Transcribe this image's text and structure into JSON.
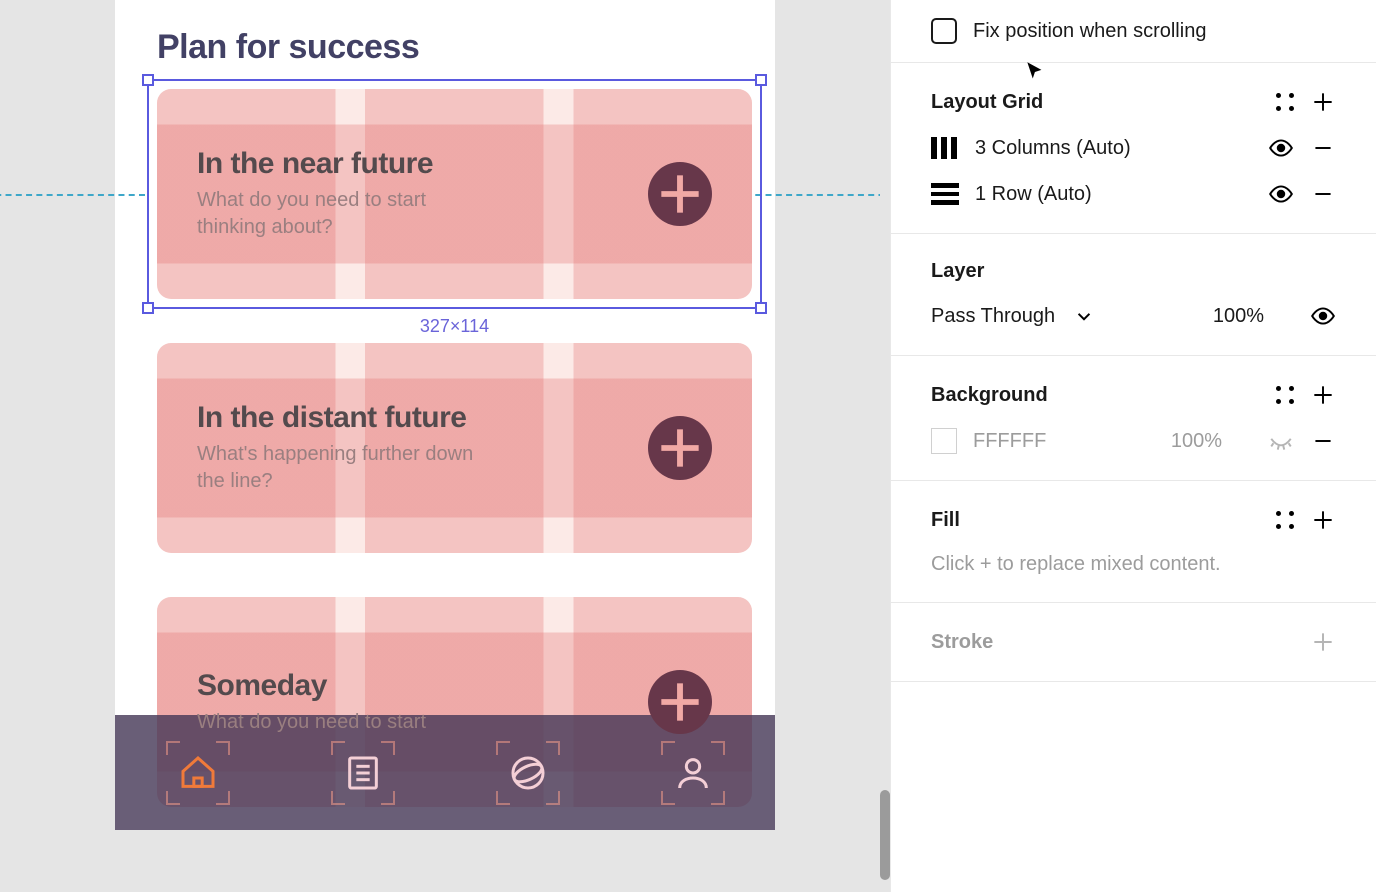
{
  "canvas": {
    "title": "Plan for success",
    "selection_dims": "327×114",
    "cards": [
      {
        "title": "In the near future",
        "sub": "What do you need to start thinking about?"
      },
      {
        "title": "In the distant future",
        "sub": "What's happening further down the line?"
      },
      {
        "title": "Someday",
        "sub": "What do you need to start"
      }
    ],
    "tabs": [
      "home",
      "list",
      "globe",
      "user"
    ]
  },
  "panel": {
    "fix_position": "Fix position when scrolling",
    "layout_grid": {
      "title": "Layout Grid",
      "items": [
        {
          "label": "3 Columns (Auto)",
          "kind": "columns"
        },
        {
          "label": "1 Row (Auto)",
          "kind": "rows"
        }
      ]
    },
    "layer": {
      "title": "Layer",
      "blend": "Pass Through",
      "opacity": "100%"
    },
    "background": {
      "title": "Background",
      "hex": "FFFFFF",
      "opacity": "100%"
    },
    "fill": {
      "title": "Fill",
      "placeholder": "Click + to replace mixed content."
    },
    "stroke": {
      "title": "Stroke"
    }
  }
}
